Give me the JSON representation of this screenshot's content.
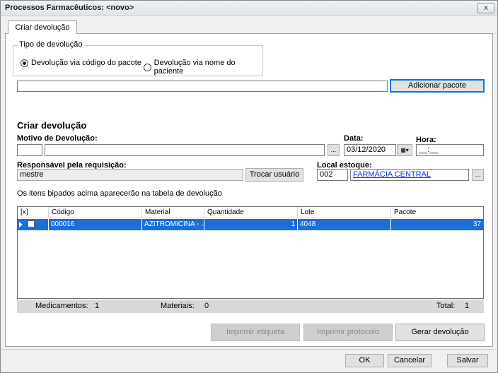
{
  "window": {
    "title": "Processos Farmacêuticos: <novo>",
    "close_label": "x"
  },
  "tab": {
    "label": "Criar devolução"
  },
  "tipo": {
    "legend": "Tipo de devolução",
    "option_codigo": "Devolução via código do pacote",
    "option_nome": "Devolução via nome do paciente",
    "selected": "codigo"
  },
  "pacote": {
    "input_value": "",
    "add_button": "Adicionar pacote"
  },
  "form": {
    "section_title": "Criar devolução",
    "motivo_label": "Motivo de Devolução:",
    "motivo_code": "",
    "motivo_text": "",
    "ellipsis": "...",
    "data_label": "Data:",
    "data_value": "03/12/2020",
    "hora_label": "Hora:",
    "hora_value": "__:__",
    "responsavel_label": "Responsável pela requisição:",
    "responsavel_value": "mestre",
    "trocar_button": "Trocar usuário",
    "local_label": "Local estoque:",
    "local_code": "002",
    "local_name": "FARMÁCIA CENTRAL",
    "info_text": "Os itens bipados acima aparecerão na tabela de devolução"
  },
  "table": {
    "columns": [
      "[x]",
      "Código",
      "Material",
      "Quantidade",
      "Lote",
      "Pacote"
    ],
    "rows": [
      {
        "checked": false,
        "codigo": "000016",
        "material": "AZITROMICINA - ...",
        "quantidade": "1",
        "lote": "4048",
        "pacote": "37",
        "selected": true
      }
    ]
  },
  "summary": {
    "medicamentos_label": "Medicamentos:",
    "medicamentos_value": "1",
    "materiais_label": "Materiais:",
    "materiais_value": "0",
    "total_label": "Total:",
    "total_value": "1"
  },
  "actions": {
    "imprimir_etiqueta": "Imprimir etiqueta",
    "imprimir_protocolo": "Imprimir protocolo",
    "gerar_devolucao": "Gerar devolução"
  },
  "footer": {
    "ok": "OK",
    "cancelar": "Cancelar",
    "salvar": "Salvar"
  },
  "colors": {
    "selection": "#1c6fd6",
    "link": "#0a2ee0",
    "focus": "#0078d7"
  }
}
